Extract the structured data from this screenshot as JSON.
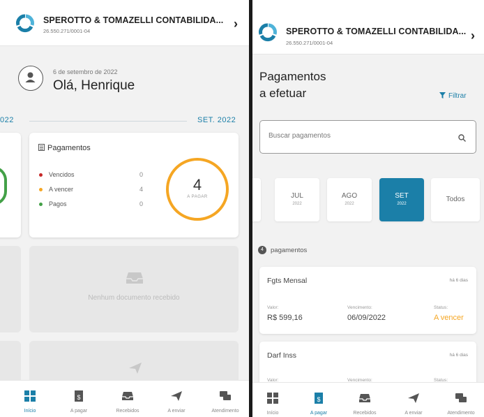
{
  "colors": {
    "accent": "#1b7fa8",
    "warning": "#f5a623",
    "danger": "#c62828",
    "success": "#43a047"
  },
  "left": {
    "company": {
      "name": "SPEROTTO & TOMAZELLI CONTABILIDA...",
      "cnpj": "26.550.271/0001-04"
    },
    "greeting": {
      "date": "6 de setembro de 2022",
      "text": "Olá, Henrique"
    },
    "months": {
      "prev": "022",
      "current": "SET. 2022"
    },
    "payments_card": {
      "title": "Pagamentos",
      "rows": [
        {
          "label": "Vencidos",
          "value": "0",
          "color": "#c62828"
        },
        {
          "label": "A vencer",
          "value": "4",
          "color": "#f5a623"
        },
        {
          "label": "Pagos",
          "value": "0",
          "color": "#43a047"
        }
      ],
      "ring_value": "4",
      "ring_label": "A PAGAR"
    },
    "received_empty": "Nenhum documento recebido"
  },
  "right": {
    "company": {
      "name": "SPEROTTO & TOMAZELLI CONTABILIDA...",
      "cnpj": "26.550.271/0001-04"
    },
    "title_line1": "Pagamentos",
    "title_line2": "a efetuar",
    "filter_label": "Filtrar",
    "search_placeholder": "Buscar pagamentos",
    "month_tabs": [
      {
        "month": "JUL",
        "year": "2022",
        "selected": false
      },
      {
        "month": "AGO",
        "year": "2022",
        "selected": false
      },
      {
        "month": "SET",
        "year": "2022",
        "selected": true
      },
      {
        "month": "Todos",
        "year": "",
        "selected": false
      }
    ],
    "count": "4",
    "count_label": "pagamentos",
    "payments": [
      {
        "name": "Fgts Mensal",
        "ago": "há 6 dias",
        "valor_label": "Valor:",
        "valor": "R$ 599,16",
        "venc_label": "Vencimento:",
        "venc": "06/09/2022",
        "status_label": "Status:",
        "status": "A vencer"
      },
      {
        "name": "Darf Inss",
        "ago": "há 6 dias",
        "valor_label": "Valor:",
        "venc_label": "Vencimento:",
        "status_label": "Status:"
      }
    ]
  },
  "tabs": [
    {
      "label": "Início",
      "icon": "grid-icon"
    },
    {
      "label": "A pagar",
      "icon": "payment-doc-icon"
    },
    {
      "label": "Recebidos",
      "icon": "inbox-icon"
    },
    {
      "label": "A enviar",
      "icon": "send-icon"
    },
    {
      "label": "Atendimento",
      "icon": "chat-icon"
    }
  ]
}
